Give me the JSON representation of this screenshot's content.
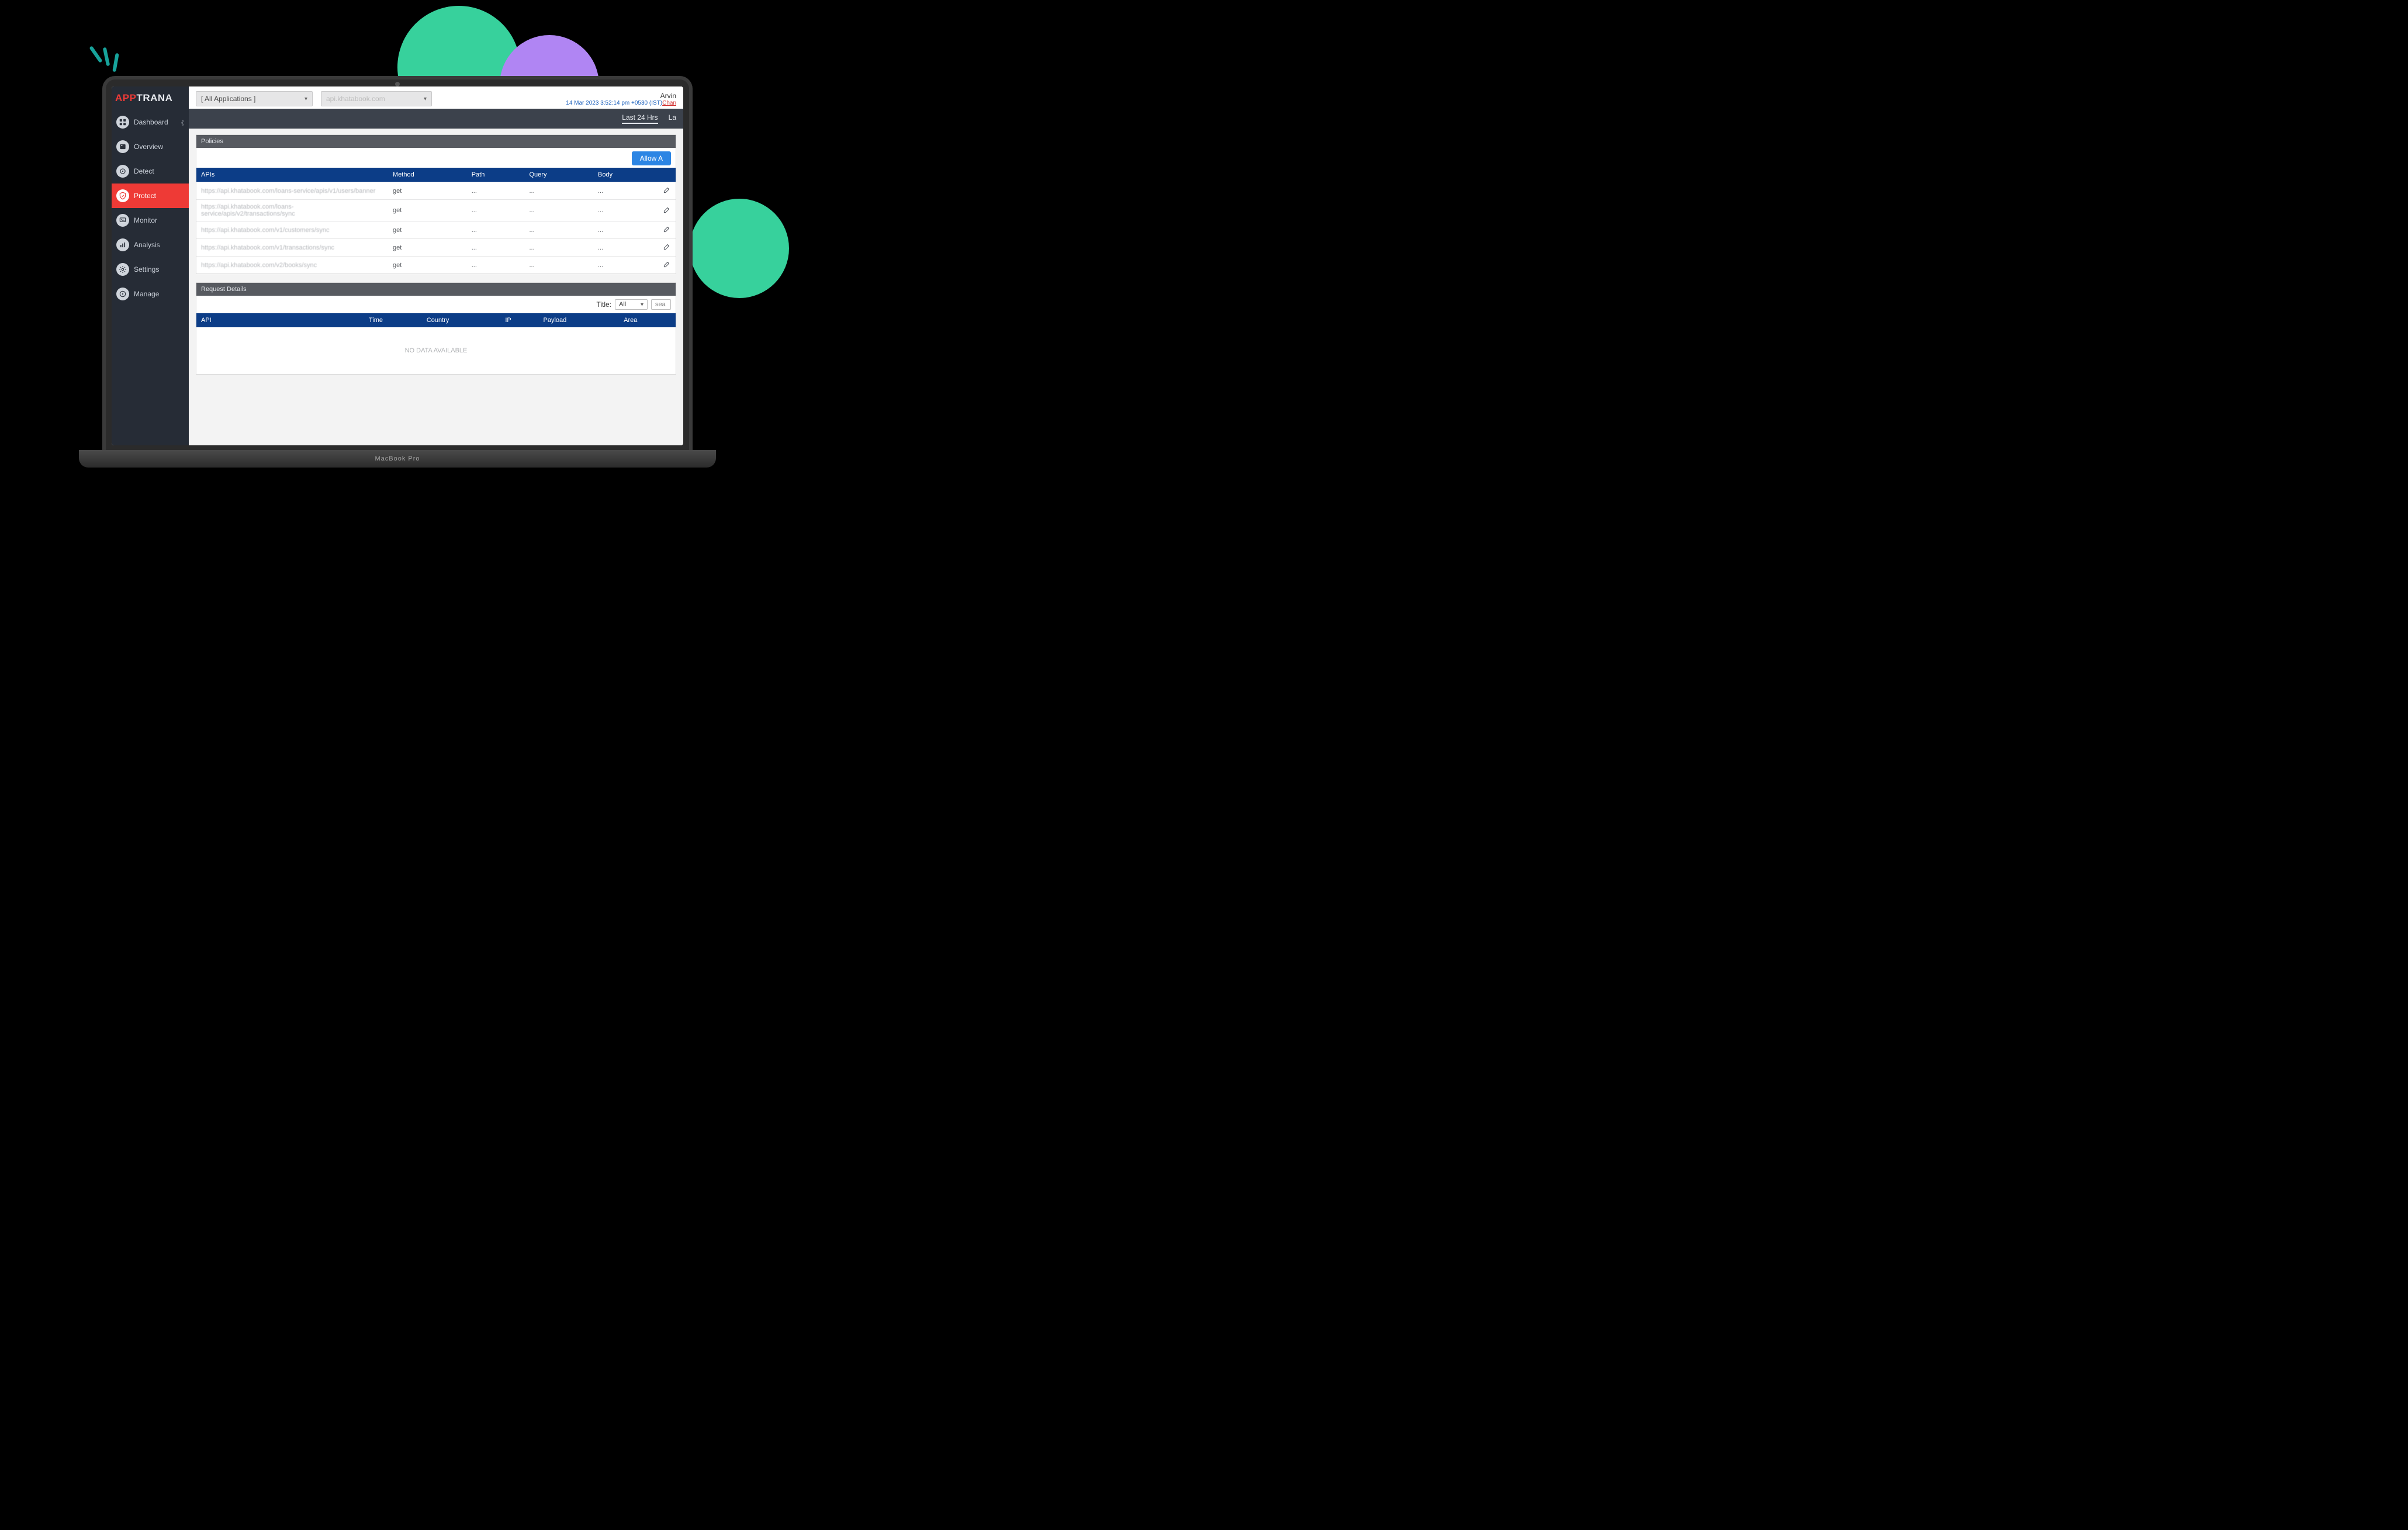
{
  "brand": {
    "app": "APP",
    "trana": "TRANA"
  },
  "sidebar": {
    "items": [
      {
        "label": "Dashboard"
      },
      {
        "label": "Overview"
      },
      {
        "label": "Detect"
      },
      {
        "label": "Protect"
      },
      {
        "label": "Monitor"
      },
      {
        "label": "Analysis"
      },
      {
        "label": "Settings"
      },
      {
        "label": "Manage"
      }
    ]
  },
  "topbar": {
    "app_select": "[ All Applications ]",
    "site_select": "api.khatabook.com",
    "user": "Arvin",
    "timestamp": "14 Mar 2023 3:52:14 pm +0530 (IST)",
    "change_label": "Chan"
  },
  "rangebar": {
    "last24": "Last 24 Hrs",
    "last_partial": "La"
  },
  "policies": {
    "title": "Policies",
    "allow_label": "Allow A",
    "headers": {
      "apis": "APIs",
      "method": "Method",
      "path": "Path",
      "query": "Query",
      "body": "Body"
    },
    "rows": [
      {
        "api": "https://api.khatabook.com/loans-service/apis/v1/users/banner",
        "method": "get",
        "path": "...",
        "query": "...",
        "body": "..."
      },
      {
        "api": "https://api.khatabook.com/loans-service/apis/v2/transactions/sync",
        "method": "get",
        "path": "...",
        "query": "...",
        "body": "..."
      },
      {
        "api": "https://api.khatabook.com/v1/customers/sync",
        "method": "get",
        "path": "...",
        "query": "...",
        "body": "..."
      },
      {
        "api": "https://api.khatabook.com/v1/transactions/sync",
        "method": "get",
        "path": "...",
        "query": "...",
        "body": "..."
      },
      {
        "api": "https://api.khatabook.com/v2/books/sync",
        "method": "get",
        "path": "...",
        "query": "...",
        "body": "..."
      }
    ]
  },
  "request": {
    "title": "Request Details",
    "filter": {
      "title_label": "Title:",
      "dd_value": "All",
      "search_placeholder": "sea"
    },
    "headers": {
      "api": "API",
      "time": "Time",
      "country": "Country",
      "ip": "IP",
      "payload": "Payload",
      "area": "Area"
    },
    "nodata": "NO DATA AVAILABLE"
  },
  "device": {
    "base_label": "MacBook Pro"
  }
}
